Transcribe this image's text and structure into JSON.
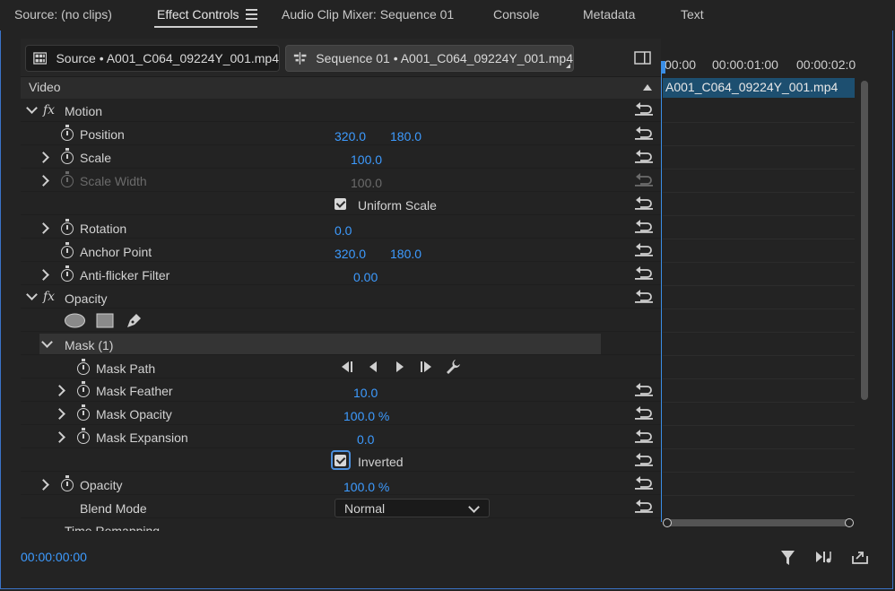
{
  "tabs": [
    {
      "label": "Source: (no clips)"
    },
    {
      "label": "Effect Controls"
    },
    {
      "label": "Audio Clip Mixer: Sequence 01"
    },
    {
      "label": "Console"
    },
    {
      "label": "Metadata"
    },
    {
      "label": "Text"
    }
  ],
  "clip_tabs": {
    "source": "Source • A001_C064_09224Y_001.mp4",
    "sequence": "Sequence 01 • A001_C064_09224Y_001.mp4"
  },
  "section": "Video",
  "motion": {
    "title": "Motion",
    "position": {
      "label": "Position",
      "x": "320.0",
      "y": "180.0"
    },
    "scale": {
      "label": "Scale",
      "value": "100.0"
    },
    "scale_width": {
      "label": "Scale Width",
      "value": "100.0"
    },
    "uniform_scale": {
      "label": "Uniform Scale",
      "checked": true
    },
    "rotation": {
      "label": "Rotation",
      "value": "0.0"
    },
    "anchor_point": {
      "label": "Anchor Point",
      "x": "320.0",
      "y": "180.0"
    },
    "anti_flicker": {
      "label": "Anti-flicker Filter",
      "value": "0.00"
    }
  },
  "opacity": {
    "title": "Opacity",
    "mask": {
      "title": "Mask (1)",
      "path": {
        "label": "Mask Path"
      },
      "feather": {
        "label": "Mask Feather",
        "value": "10.0"
      },
      "opacity": {
        "label": "Mask Opacity",
        "value": "100.0 %"
      },
      "expansion": {
        "label": "Mask Expansion",
        "value": "0.0"
      },
      "inverted": {
        "label": "Inverted",
        "checked": true
      }
    },
    "opacity_value": {
      "label": "Opacity",
      "value": "100.0 %"
    },
    "blend_mode": {
      "label": "Blend Mode",
      "value": "Normal"
    }
  },
  "next_section_partial": "Time Remapping",
  "timeline": {
    "ruler": [
      "00:00",
      "00:00:01:00",
      "00:00:02:0"
    ],
    "clip_name": "A001_C064_09224Y_001.mp4"
  },
  "footer": {
    "timecode": "00:00:00:00"
  },
  "colors": {
    "accent": "#3d9bff",
    "clip": "#1d4f70",
    "playhead": "#3a8ee6"
  }
}
